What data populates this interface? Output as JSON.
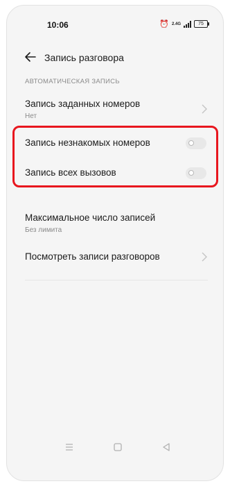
{
  "status_bar": {
    "time": "10:06",
    "network": "2.4G",
    "battery": "75",
    "icons": [
      "alarm-icon",
      "signal-icon",
      "battery-icon"
    ]
  },
  "header": {
    "title": "Запись разговора",
    "back_icon": "arrow-left-icon"
  },
  "section_label": "АВТОМАТИЧЕСКАЯ ЗАПИСЬ",
  "rows": {
    "selected_numbers": {
      "title": "Запись заданных номеров",
      "subtitle": "Нет"
    },
    "unknown_numbers": {
      "title": "Запись незнакомых номеров",
      "toggle": "off"
    },
    "all_calls": {
      "title": "Запись всех вызовов",
      "toggle": "off"
    },
    "max_records": {
      "title": "Максимальное число записей",
      "subtitle": "Без лимита"
    },
    "view_records": {
      "title": "Посмотреть записи разговоров"
    }
  },
  "highlight_color": "#e8161e",
  "nav_bar": {
    "icons": [
      "menu-icon",
      "home-square-icon",
      "back-triangle-icon"
    ]
  }
}
